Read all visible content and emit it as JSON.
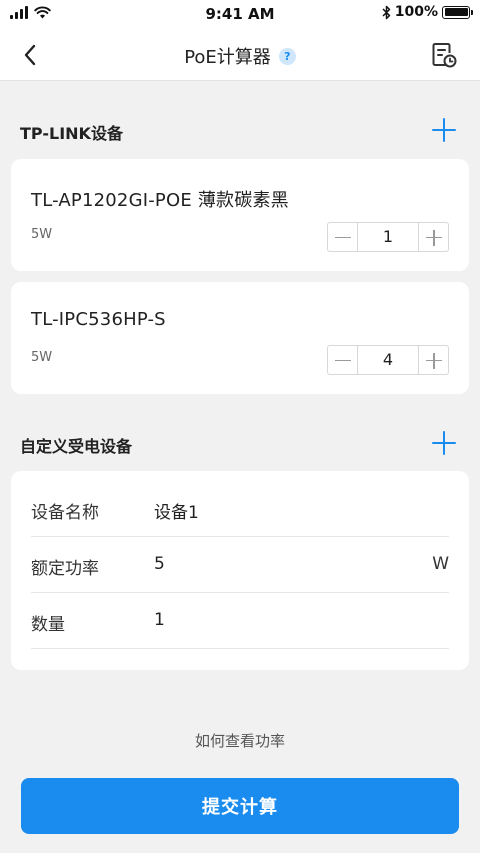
{
  "status_bar": {
    "time": "9:41 AM",
    "battery": "100%"
  },
  "nav": {
    "title": "PoE计算器",
    "help": "?"
  },
  "tplink_section": {
    "title": "TP-LINK设备",
    "devices": [
      {
        "name": "TL-AP1202GI-POE 薄款碳素黑",
        "power": "5W",
        "quantity": "1"
      },
      {
        "name": "TL-IPC536HP-S",
        "power": "5W",
        "quantity": "4"
      }
    ]
  },
  "custom_section": {
    "title": "自定义受电设备",
    "fields": {
      "name_label": "设备名称",
      "name_value": "设备1",
      "power_label": "额定功率",
      "power_value": "5",
      "power_unit": "W",
      "qty_label": "数量",
      "qty_value": "1"
    }
  },
  "help_link": "如何查看功率",
  "submit_label": "提交计算",
  "colors": {
    "accent": "#1a8cf0",
    "background": "#f1f1f2",
    "card": "#ffffff"
  }
}
